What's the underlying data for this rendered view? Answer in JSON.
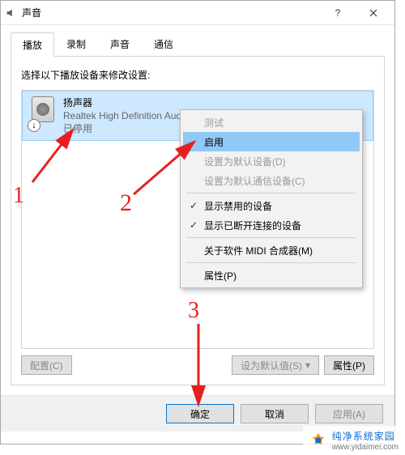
{
  "title": "声音",
  "tabs": [
    "播放",
    "录制",
    "声音",
    "通信"
  ],
  "activeTab": 0,
  "hint": "选择以下播放设备来修改设置:",
  "device": {
    "name": "扬声器",
    "desc": "Realtek High Definition Audio",
    "status": "已停用",
    "badge": "↓"
  },
  "contextMenu": {
    "groups": [
      [
        {
          "label": "测试",
          "disabled": true,
          "checked": false
        },
        {
          "label": "启用",
          "disabled": false,
          "checked": false,
          "selected": true
        },
        {
          "label": "设置为默认设备(D)",
          "disabled": true,
          "checked": false
        },
        {
          "label": "设置为默认通信设备(C)",
          "disabled": true,
          "checked": false
        }
      ],
      [
        {
          "label": "显示禁用的设备",
          "disabled": false,
          "checked": true
        },
        {
          "label": "显示已断开连接的设备",
          "disabled": false,
          "checked": true
        }
      ],
      [
        {
          "label": "关于软件 MIDI 合成器(M)",
          "disabled": false,
          "checked": false
        }
      ],
      [
        {
          "label": "属性(P)",
          "disabled": false,
          "checked": false
        }
      ]
    ]
  },
  "panelButtons": {
    "configure": "配置(C)",
    "setDefault": "设为默认值(S)",
    "properties": "属性(P)"
  },
  "dialogButtons": {
    "ok": "确定",
    "cancel": "取消",
    "apply": "应用(A)"
  },
  "annotations": {
    "a1": "1",
    "a2": "2",
    "a3": "3"
  },
  "watermark": {
    "line1": "纯净系统家园",
    "line2": "www.yidaimei.com"
  }
}
